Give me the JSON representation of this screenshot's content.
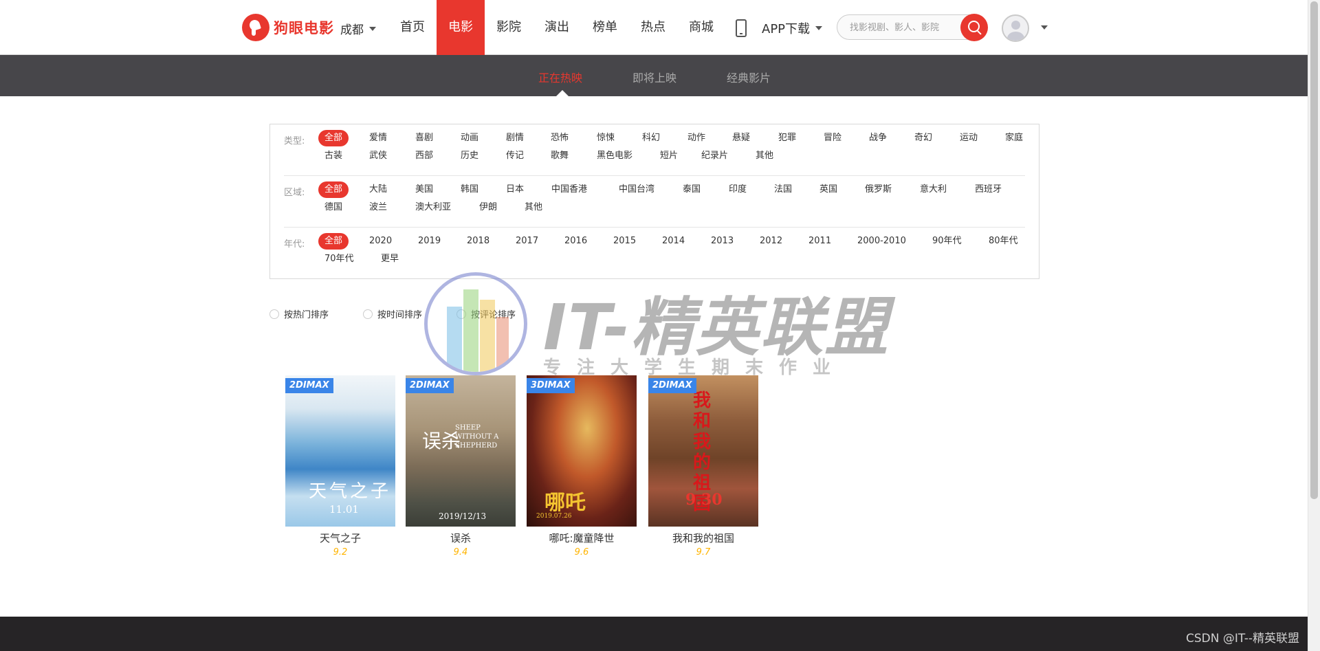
{
  "header": {
    "logo_text": "狗眼电影",
    "city": "成都",
    "nav": [
      {
        "label": "首页",
        "active": false
      },
      {
        "label": "电影",
        "active": true
      },
      {
        "label": "影院",
        "active": false
      },
      {
        "label": "演出",
        "active": false
      },
      {
        "label": "榜单",
        "active": false
      },
      {
        "label": "热点",
        "active": false
      },
      {
        "label": "商城",
        "active": false
      }
    ],
    "app_download": "APP下载",
    "search_placeholder": "找影视剧、影人、影院"
  },
  "subnav": {
    "tabs": [
      {
        "label": "正在热映",
        "active": true
      },
      {
        "label": "即将上映",
        "active": false
      },
      {
        "label": "经典影片",
        "active": false
      }
    ]
  },
  "filters": {
    "type": {
      "label": "类型:",
      "tags": [
        "全部",
        "爱情",
        "喜剧",
        "动画",
        "剧情",
        "恐怖",
        "惊悚",
        "科幻",
        "动作",
        "悬疑",
        "犯罪",
        "冒险",
        "战争",
        "奇幻",
        "运动",
        "家庭",
        "古装",
        "武侠",
        "西部",
        "历史",
        "传记",
        "歌舞",
        "黑色电影",
        "短片",
        "纪录片",
        "其他"
      ]
    },
    "region": {
      "label": "区域:",
      "tags": [
        "全部",
        "大陆",
        "美国",
        "韩国",
        "日本",
        "中国香港",
        "中国台湾",
        "泰国",
        "印度",
        "法国",
        "英国",
        "俄罗斯",
        "意大利",
        "西班牙",
        "德国",
        "波兰",
        "澳大利亚",
        "伊朗",
        "其他"
      ]
    },
    "year": {
      "label": "年代:",
      "tags": [
        "全部",
        "2020",
        "2019",
        "2018",
        "2017",
        "2016",
        "2015",
        "2014",
        "2013",
        "2012",
        "2011",
        "2000-2010",
        "90年代",
        "80年代",
        "70年代",
        "更早"
      ]
    }
  },
  "sort": [
    "按热门排序",
    "按时间排序",
    "按评论排序"
  ],
  "movies": [
    {
      "title": "天气之子",
      "score": "9.2",
      "badge": "2DIMAX",
      "poster_title": "天气之子",
      "poster_date": "11.01"
    },
    {
      "title": "误杀",
      "score": "9.4",
      "badge": "2DIMAX",
      "poster_title": "误杀",
      "poster_subtitle": "SHEEP WITHOUT A SHEPHERD",
      "poster_date": "2019/12/13"
    },
    {
      "title": "哪吒:魔童降世",
      "score": "9.6",
      "badge": "3DIMAX",
      "poster_title": "哪吒",
      "poster_date": "2019.07.26"
    },
    {
      "title": "我和我的祖国",
      "score": "9.7",
      "badge": "2DIMAX",
      "poster_title": "我和我的祖国",
      "poster_date": "9.30"
    }
  ],
  "watermark": {
    "title": "IT-精英联盟",
    "subtitle": "专注大学生期末作业"
  },
  "footer": {
    "credit": "CSDN @IT--精英联盟"
  },
  "colors": {
    "brand": "#e8372e",
    "subnav_bg": "#47464a",
    "footer_bg": "#262426",
    "score": "#ffb400",
    "badge": "#3a85e8"
  }
}
